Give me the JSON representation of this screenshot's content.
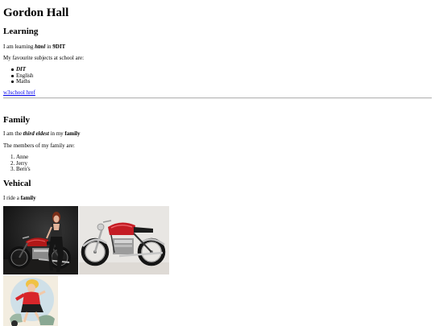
{
  "title": "Gordon Hall",
  "learning": {
    "heading": "Learning",
    "line_prefix": "I am learning ",
    "line_em": "html",
    "line_mid": " in ",
    "line_strong": "9DIT",
    "subjects_intro": "My favourite subjects at school are:",
    "subjects": [
      "DIT",
      "English",
      "Maths"
    ],
    "link_text": "w3school href"
  },
  "family": {
    "heading": "Family",
    "line_prefix": "I am the ",
    "line_em": "third eldest",
    "line_mid": " in my ",
    "line_strong": "family",
    "members_intro": "The members of my family are:",
    "members": [
      "Anne",
      "Jerry",
      "Bern's"
    ]
  },
  "vehicle": {
    "heading": "Vehical",
    "line_prefix": "I ride a ",
    "line_strong": "family"
  },
  "photos": [
    "motorcycle-with-rider-photo",
    "red-motorcycle-photo",
    "pinup-scooter-illustration"
  ],
  "colors": {
    "link": "#0000ee",
    "hr": "#b8b8b8"
  }
}
